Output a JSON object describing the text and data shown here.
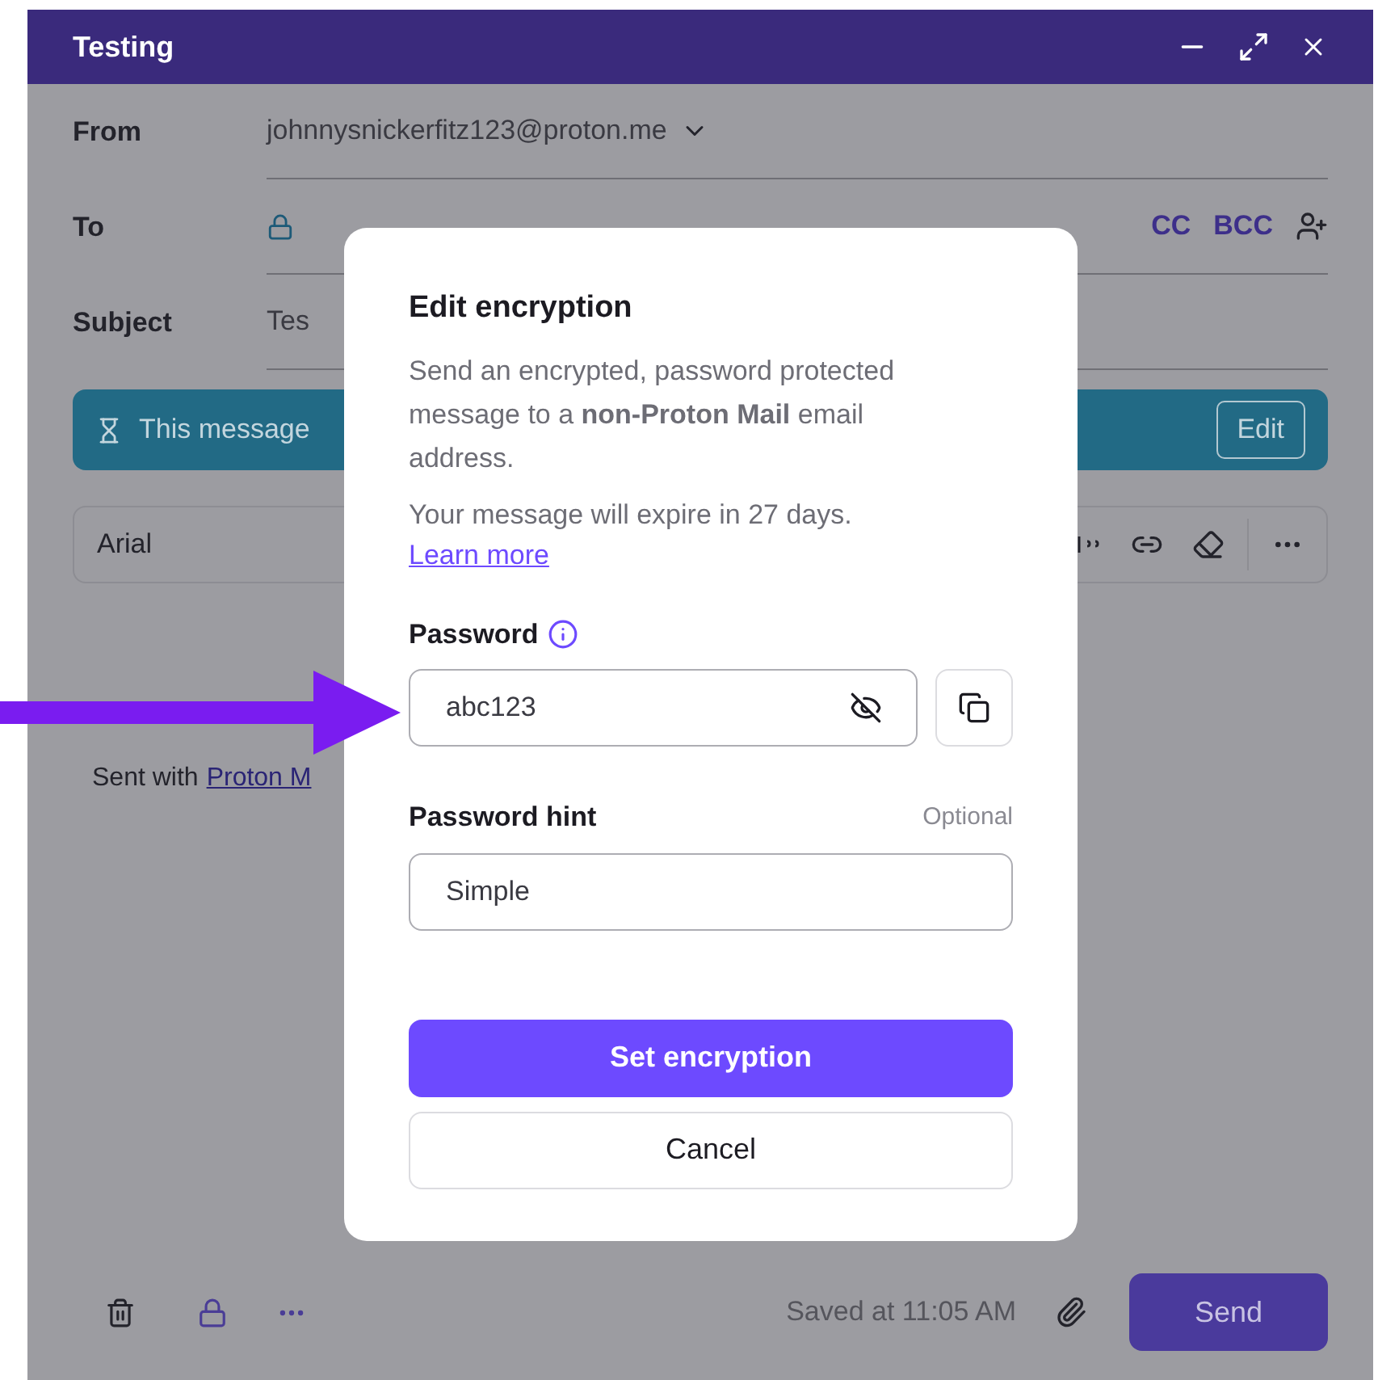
{
  "window": {
    "title": "Testing"
  },
  "compose": {
    "from_label": "From",
    "from_value": "johnnysnickerfitz123@proton.me",
    "to_label": "To",
    "cc": "CC",
    "bcc": "BCC",
    "subject_label": "Subject",
    "subject_value": "Tes"
  },
  "banner": {
    "text": "This message",
    "button": "Edit"
  },
  "toolbar": {
    "font": "Arial"
  },
  "body": {
    "text": "Sent with",
    "link": "Proton M"
  },
  "footer": {
    "saved": "Saved at 11:05 AM",
    "send": "Send"
  },
  "dialog": {
    "title": "Edit encryption",
    "description": "Send an encrypted, password protected message to a **non-Proton Mail** email address.",
    "expiry": "Your message will expire in 27 days.",
    "learn_more": "Learn more",
    "password": {
      "label": "Password",
      "value": "abc123"
    },
    "hint": {
      "label": "Password hint",
      "optional": "Optional",
      "value": "Simple"
    },
    "primary": "Set encryption",
    "cancel": "Cancel"
  }
}
